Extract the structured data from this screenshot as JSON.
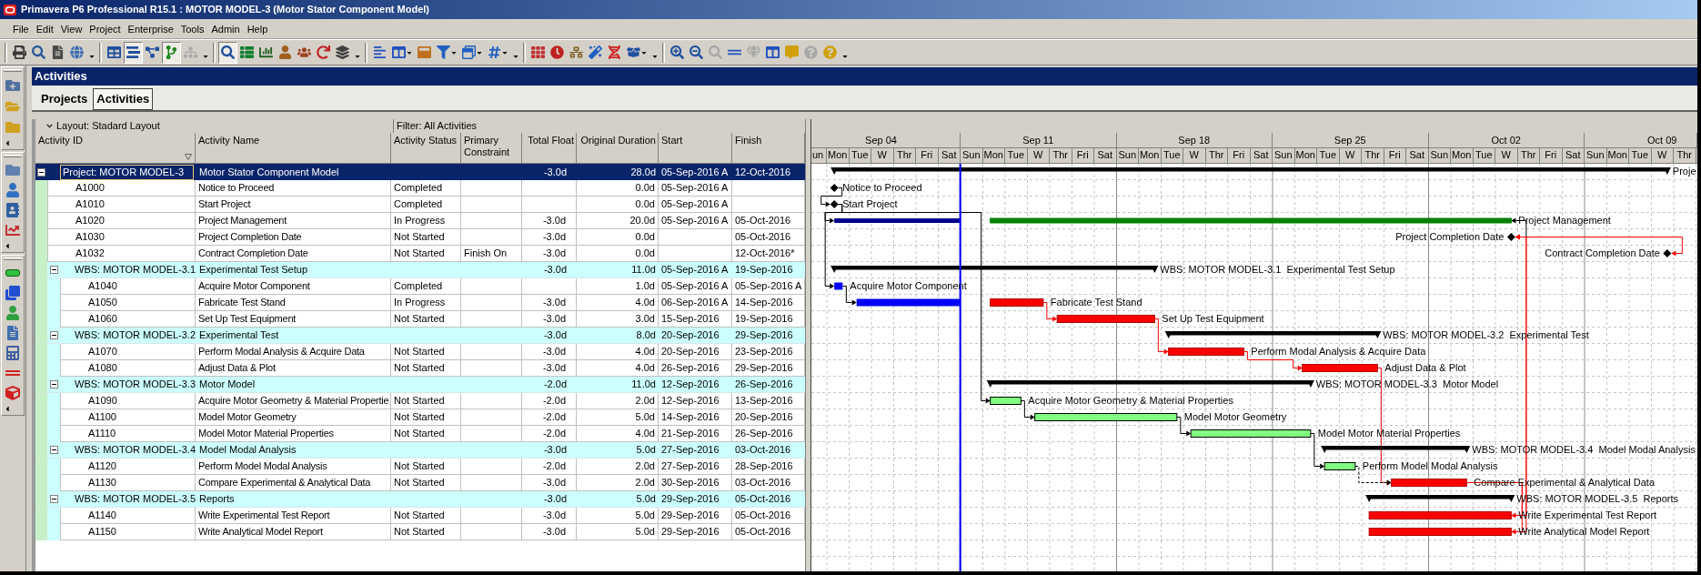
{
  "window": {
    "title": "Primavera P6 Professional R15.1 : MOTOR MODEL-3 (Motor Stator Component Model)"
  },
  "menu": [
    "File",
    "Edit",
    "View",
    "Project",
    "Enterprise",
    "Tools",
    "Admin",
    "Help"
  ],
  "toolbar": [
    {
      "on": false,
      "disabled": false
    },
    {
      "on": false,
      "disabled": false
    },
    {
      "on": false,
      "disabled": false
    },
    {
      "on": false,
      "disabled": false
    },
    {
      "on": false,
      "disabled": false
    },
    {
      "on": true,
      "disabled": false
    },
    {
      "on": false,
      "disabled": false
    },
    {
      "on": true,
      "disabled": false
    },
    {
      "on": false,
      "disabled": true
    },
    {
      "on": true,
      "disabled": false
    },
    {
      "on": false,
      "disabled": false
    },
    {
      "on": false,
      "disabled": false
    },
    {
      "on": false,
      "disabled": false
    },
    {
      "on": false,
      "disabled": false
    },
    {
      "on": false,
      "disabled": false
    },
    {
      "on": false,
      "disabled": false
    },
    {
      "on": false,
      "disabled": false
    },
    {
      "on": false,
      "disabled": false
    },
    {
      "on": false,
      "disabled": false
    },
    {
      "on": false,
      "disabled": false
    },
    {
      "on": false,
      "disabled": false
    },
    {
      "on": false,
      "disabled": false
    },
    {
      "on": false,
      "disabled": false
    },
    {
      "on": false,
      "disabled": false
    },
    {
      "on": false,
      "disabled": false
    },
    {
      "on": false,
      "disabled": false
    },
    {
      "on": false,
      "disabled": false
    },
    {
      "on": false,
      "disabled": false
    },
    {
      "on": false,
      "disabled": false
    },
    {
      "on": false,
      "disabled": false
    },
    {
      "on": false,
      "disabled": true
    },
    {
      "on": false,
      "disabled": false
    },
    {
      "on": false,
      "disabled": true
    },
    {
      "on": false,
      "disabled": false
    },
    {
      "on": false,
      "disabled": false
    },
    {
      "on": false,
      "disabled": true
    },
    {
      "on": false,
      "disabled": false
    }
  ],
  "panel": {
    "title": "Activities"
  },
  "tabs": [
    {
      "label": "Projects",
      "selected": false
    },
    {
      "label": "Activities",
      "selected": true
    }
  ],
  "layout_bar": {
    "layout": "Layout: Stadard Layout",
    "filter": "Filter: All Activities"
  },
  "table": {
    "columns": [
      "Activity ID",
      "Activity Name",
      "Activity Status",
      "Primary Constraint",
      "Total Float",
      "Original Duration",
      "Start",
      "Finish"
    ],
    "rows": [
      {
        "kind": "project",
        "label": "Project: MOTOR MODEL-3",
        "name": "Motor Stator Component Model",
        "selected": true,
        "expanded": true,
        "total_float": "-3.0d",
        "original_duration": "28.0d",
        "start": "05-Sep-2016 A",
        "finish": "12-Oct-2016",
        "children": [
          {
            "kind": "activity",
            "id": "A1000",
            "name": "Notice to Proceed",
            "status": "Completed",
            "original_duration": "0.0d",
            "start": "05-Sep-2016 A",
            "selected": false
          },
          {
            "kind": "activity",
            "id": "A1010",
            "name": "Start Project",
            "status": "Completed",
            "original_duration": "0.0d",
            "start": "05-Sep-2016 A",
            "selected": false
          },
          {
            "kind": "activity",
            "id": "A1020",
            "name": "Project Management",
            "status": "In Progress",
            "total_float": "-3.0d",
            "original_duration": "20.0d",
            "start": "05-Sep-2016 A",
            "finish": "05-Oct-2016",
            "selected": false
          },
          {
            "kind": "activity",
            "id": "A1030",
            "name": "Project Completion Date",
            "status": "Not Started",
            "total_float": "-3.0d",
            "original_duration": "0.0d",
            "finish": "05-Oct-2016",
            "selected": false
          },
          {
            "kind": "activity",
            "id": "A1032",
            "name": "Contract Completion Date",
            "status": "Not Started",
            "constraint": "Finish On",
            "total_float": "-3.0d",
            "original_duration": "0.0d",
            "finish": "12-Oct-2016*",
            "selected": false
          },
          {
            "kind": "wbs",
            "label": "WBS: MOTOR MODEL-3.1",
            "name": "Experimental Test Setup",
            "selected": false,
            "expanded": true,
            "total_float": "-3.0d",
            "original_duration": "11.0d",
            "start": "05-Sep-2016 A",
            "finish": "19-Sep-2016",
            "children": [
              {
                "kind": "activity",
                "id": "A1040",
                "name": "Acquire Motor Component",
                "status": "Completed",
                "original_duration": "1.0d",
                "start": "05-Sep-2016 A",
                "finish": "05-Sep-2016 A",
                "selected": false
              },
              {
                "kind": "activity",
                "id": "A1050",
                "name": "Fabricate Test Stand",
                "status": "In Progress",
                "total_float": "-3.0d",
                "original_duration": "4.0d",
                "start": "06-Sep-2016 A",
                "finish": "14-Sep-2016",
                "selected": false
              },
              {
                "kind": "activity",
                "id": "A1060",
                "name": "Set Up Test Equipment",
                "status": "Not Started",
                "total_float": "-3.0d",
                "original_duration": "3.0d",
                "start": "15-Sep-2016",
                "finish": "19-Sep-2016",
                "selected": false
              }
            ]
          },
          {
            "kind": "wbs",
            "label": "WBS: MOTOR MODEL-3.2",
            "name": "Experimental Test",
            "selected": false,
            "expanded": true,
            "total_float": "-3.0d",
            "original_duration": "8.0d",
            "start": "20-Sep-2016",
            "finish": "29-Sep-2016",
            "children": [
              {
                "kind": "activity",
                "id": "A1070",
                "name": "Perform Modal Analysis & Acquire Data",
                "status": "Not Started",
                "total_float": "-3.0d",
                "original_duration": "4.0d",
                "start": "20-Sep-2016",
                "finish": "23-Sep-2016",
                "selected": false
              },
              {
                "kind": "activity",
                "id": "A1080",
                "name": "Adjust Data & Plot",
                "status": "Not Started",
                "total_float": "-3.0d",
                "original_duration": "4.0d",
                "start": "26-Sep-2016",
                "finish": "29-Sep-2016",
                "selected": false
              }
            ]
          },
          {
            "kind": "wbs",
            "label": "WBS: MOTOR MODEL-3.3",
            "name": "Motor Model",
            "selected": false,
            "expanded": true,
            "total_float": "-2.0d",
            "original_duration": "11.0d",
            "start": "12-Sep-2016",
            "finish": "26-Sep-2016",
            "children": [
              {
                "kind": "activity",
                "id": "A1090",
                "name": "Acquire Motor Geometry & Material Propertie",
                "status": "Not Started",
                "total_float": "-2.0d",
                "original_duration": "2.0d",
                "start": "12-Sep-2016",
                "finish": "13-Sep-2016",
                "selected": false
              },
              {
                "kind": "activity",
                "id": "A1100",
                "name": "Model Motor Geometry",
                "status": "Not Started",
                "total_float": "-2.0d",
                "original_duration": "5.0d",
                "start": "14-Sep-2016",
                "finish": "20-Sep-2016",
                "selected": false
              },
              {
                "kind": "activity",
                "id": "A1110",
                "name": "Model Motor Material Properties",
                "status": "Not Started",
                "total_float": "-2.0d",
                "original_duration": "4.0d",
                "start": "21-Sep-2016",
                "finish": "26-Sep-2016",
                "selected": false
              }
            ]
          },
          {
            "kind": "wbs",
            "label": "WBS: MOTOR MODEL-3.4",
            "name": "Model Modal Analysis",
            "selected": false,
            "expanded": true,
            "total_float": "-3.0d",
            "original_duration": "5.0d",
            "start": "27-Sep-2016",
            "finish": "03-Oct-2016",
            "children": [
              {
                "kind": "activity",
                "id": "A1120",
                "name": "Perform Model Modal Analysis",
                "status": "Not Started",
                "total_float": "-2.0d",
                "original_duration": "2.0d",
                "start": "27-Sep-2016",
                "finish": "28-Sep-2016",
                "selected": false
              },
              {
                "kind": "activity",
                "id": "A1130",
                "name": "Compare Experimental & Analytical Data",
                "status": "Not Started",
                "total_float": "-3.0d",
                "original_duration": "2.0d",
                "start": "30-Sep-2016",
                "finish": "03-Oct-2016",
                "selected": false
              }
            ]
          },
          {
            "kind": "wbs",
            "label": "WBS: MOTOR MODEL-3.5",
            "name": "Reports",
            "selected": false,
            "expanded": true,
            "total_float": "-3.0d",
            "original_duration": "5.0d",
            "start": "29-Sep-2016",
            "finish": "05-Oct-2016",
            "children": [
              {
                "kind": "activity",
                "id": "A1140",
                "name": "Write Experimental Test Report",
                "status": "Not Started",
                "total_float": "-3.0d",
                "original_duration": "5.0d",
                "start": "29-Sep-2016",
                "finish": "05-Oct-2016",
                "selected": false
              },
              {
                "kind": "activity",
                "id": "A1150",
                "name": "Write Analytical Model Report",
                "status": "Not Started",
                "total_float": "-3.0d",
                "original_duration": "5.0d",
                "start": "29-Sep-2016",
                "finish": "05-Oct-2016",
                "selected": false
              }
            ]
          }
        ]
      }
    ]
  },
  "gantt": {
    "weeks": [
      "Sep 04",
      "Sep 11",
      "Sep 18",
      "Sep 25",
      "Oct 02",
      "Oct 09"
    ],
    "days": [
      "un",
      "Mon",
      "Tue",
      "W",
      "Thr",
      "Fri",
      "Sat",
      "Sun",
      "Mon",
      "Tue",
      "W",
      "Thr",
      "Fri",
      "Sat",
      "Sun",
      "Mon",
      "Tue",
      "W",
      "Thr",
      "Fri",
      "Sat",
      "Sun",
      "Mon",
      "Tue",
      "W",
      "Thr",
      "Fri",
      "Sat",
      "Sun",
      "Mon",
      "Tue",
      "W",
      "Thr",
      "Fri",
      "Sat",
      "Sun",
      "Mon",
      "Tue",
      "W",
      "Thr"
    ],
    "data_date": {
      "level": 0.168
    },
    "rows": [
      {
        "kind": "summary",
        "label": "Proje"
      },
      {
        "kind": "milestone",
        "label": "Notice to Proceed",
        "label_left": false
      },
      {
        "kind": "milestone",
        "label": "Start Project",
        "label_left": false
      },
      {
        "kind": "effort",
        "label": "Project Management",
        "started": true,
        "finished": false,
        "critical": false
      },
      {
        "kind": "milestone",
        "label": "Project Completion Date",
        "label_left": true,
        "critical": true
      },
      {
        "kind": "milestone",
        "label": "Contract Completion Date",
        "label_left": true,
        "critical": true
      },
      {
        "kind": "summary",
        "label": "WBS: MOTOR MODEL-3.1  Experimental Test Setup"
      },
      {
        "kind": "task",
        "label": "Acquire Motor Component",
        "started": true,
        "finished": true,
        "critical": false
      },
      {
        "kind": "task",
        "label": "Fabricate Test Stand",
        "started": true,
        "finished": false,
        "critical": true
      },
      {
        "kind": "task",
        "label": "Set Up Test Equipment",
        "started": false,
        "finished": false,
        "critical": true
      },
      {
        "kind": "summary",
        "label": "WBS: MOTOR MODEL-3.2  Experimental Test"
      },
      {
        "kind": "task",
        "label": "Perform Modal Analysis & Acquire Data",
        "started": false,
        "finished": false,
        "critical": true
      },
      {
        "kind": "task",
        "label": "Adjust Data & Plot",
        "started": false,
        "finished": false,
        "critical": true
      },
      {
        "kind": "summary",
        "label": "WBS: MOTOR MODEL-3.3  Motor Model"
      },
      {
        "kind": "task",
        "label": "Acquire Motor Geometry & Material Properties",
        "started": false,
        "finished": false,
        "critical": false
      },
      {
        "kind": "task",
        "label": "Model Motor Geometry",
        "started": false,
        "finished": false,
        "critical": false
      },
      {
        "kind": "task",
        "label": "Model Motor Material Properties",
        "started": false,
        "finished": false,
        "critical": false
      },
      {
        "kind": "summary",
        "label": "WBS: MOTOR MODEL-3.4  Model Modal Analysis"
      },
      {
        "kind": "task",
        "label": "Perform Model Modal Analysis",
        "started": false,
        "finished": false,
        "critical": false
      },
      {
        "kind": "task",
        "label": "Compare Experimental & Analytical Data",
        "started": false,
        "finished": false,
        "critical": true
      },
      {
        "kind": "summary",
        "label": "WBS: MOTOR MODEL-3.5  Reports"
      },
      {
        "kind": "task",
        "label": "Write Experimental Test Report",
        "started": false,
        "finished": false,
        "critical": true
      },
      {
        "kind": "task",
        "label": "Write Analytical Model Report",
        "started": false,
        "finished": false,
        "critical": true
      }
    ]
  }
}
